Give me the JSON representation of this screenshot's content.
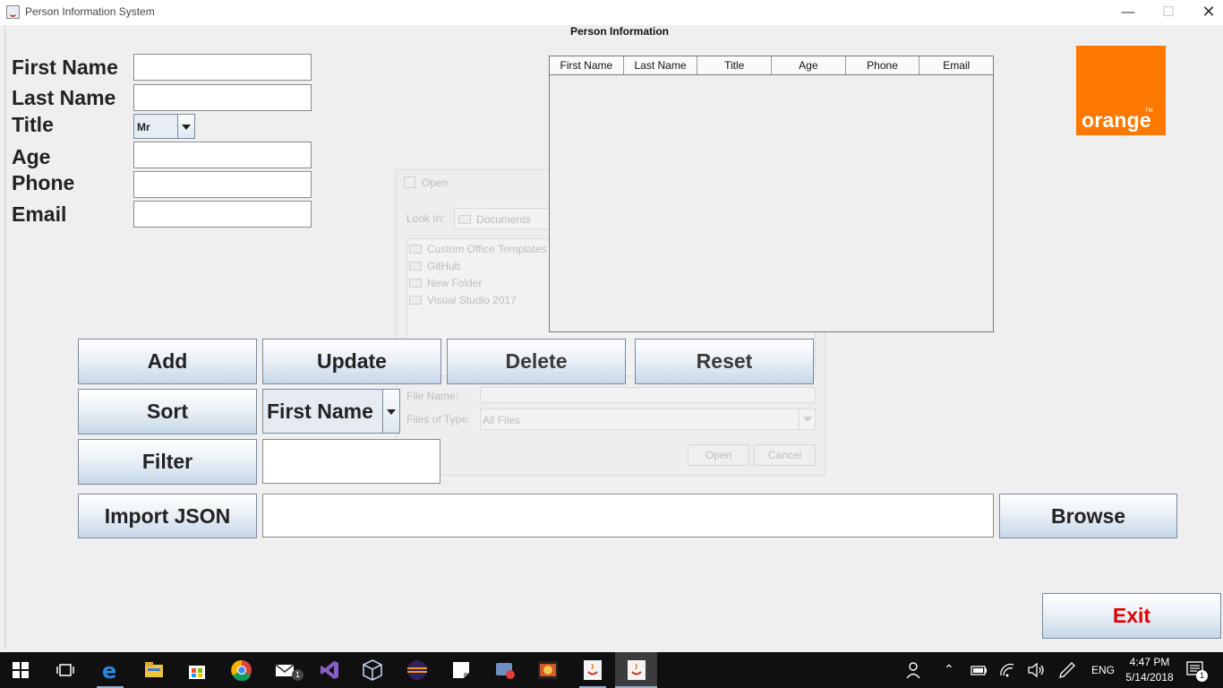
{
  "window": {
    "title": "Person Information System",
    "controls": {
      "minimize": "—",
      "maximize": "☐",
      "close": "✕"
    }
  },
  "form": {
    "first_name_label": "First Name",
    "last_name_label": "Last Name",
    "title_label": "Title",
    "title_value": "Mr",
    "age_label": "Age",
    "phone_label": "Phone",
    "email_label": "Email"
  },
  "section_title": "Person Information",
  "table": {
    "columns": [
      "First Name",
      "Last Name",
      "Title",
      "Age",
      "Phone",
      "Email"
    ],
    "rows": []
  },
  "logo": {
    "text": "orange",
    "tm": "TM",
    "color": "#ff7900"
  },
  "open_dialog": {
    "title": "Open",
    "look_in_label": "Look In:",
    "look_in_value": "Documents",
    "folders": [
      "Custom Office Templates",
      "GitHub",
      "New Folder",
      "Visual Studio 2017"
    ],
    "file_name_label": "File Name:",
    "file_name_value": "",
    "files_of_type_label": "Files of Type:",
    "files_of_type_value": "All Files",
    "open_button": "Open",
    "cancel_button": "Cancel"
  },
  "buttons": {
    "add": "Add",
    "update": "Update",
    "delete": "Delete",
    "reset": "Reset",
    "sort": "Sort",
    "filter": "Filter",
    "import_json": "Import JSON",
    "browse": "Browse",
    "exit": "Exit"
  },
  "sort_by": {
    "value": "First Name"
  },
  "filter_value": "",
  "json_path_value": "",
  "taskbar": {
    "language": "ENG",
    "time": "4:47 PM",
    "date": "5/14/2018",
    "notification_count": "1",
    "mail_badge": "1"
  },
  "colors": {
    "exit_text": "#e00000",
    "button_gradient_bottom": "#c6d7e8",
    "taskbar": "#101010"
  }
}
